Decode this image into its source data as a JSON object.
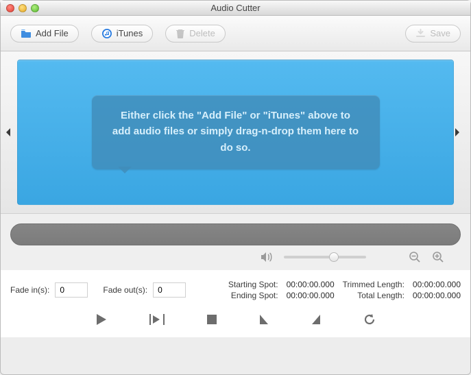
{
  "window": {
    "title": "Audio Cutter"
  },
  "toolbar": {
    "addFile": "Add File",
    "itunes": "iTunes",
    "delete": "Delete",
    "save": "Save"
  },
  "dropzone": {
    "hint": "Either click the \"Add File\" or \"iTunes\" above to add audio files or simply drag-n-drop them here to do so."
  },
  "volume": {
    "position": 0.55
  },
  "fade": {
    "inLabel": "Fade in(s):",
    "inValue": "0",
    "outLabel": "Fade out(s):",
    "outValue": "0"
  },
  "spots": {
    "startLabel": "Starting Spot:",
    "startValue": "00:00:00.000",
    "endLabel": "Ending Spot:",
    "endValue": "00:00:00.000",
    "trimLabel": "Trimmed Length:",
    "trimValue": "00:00:00.000",
    "totalLabel": "Total Length:",
    "totalValue": "00:00:00.000"
  }
}
